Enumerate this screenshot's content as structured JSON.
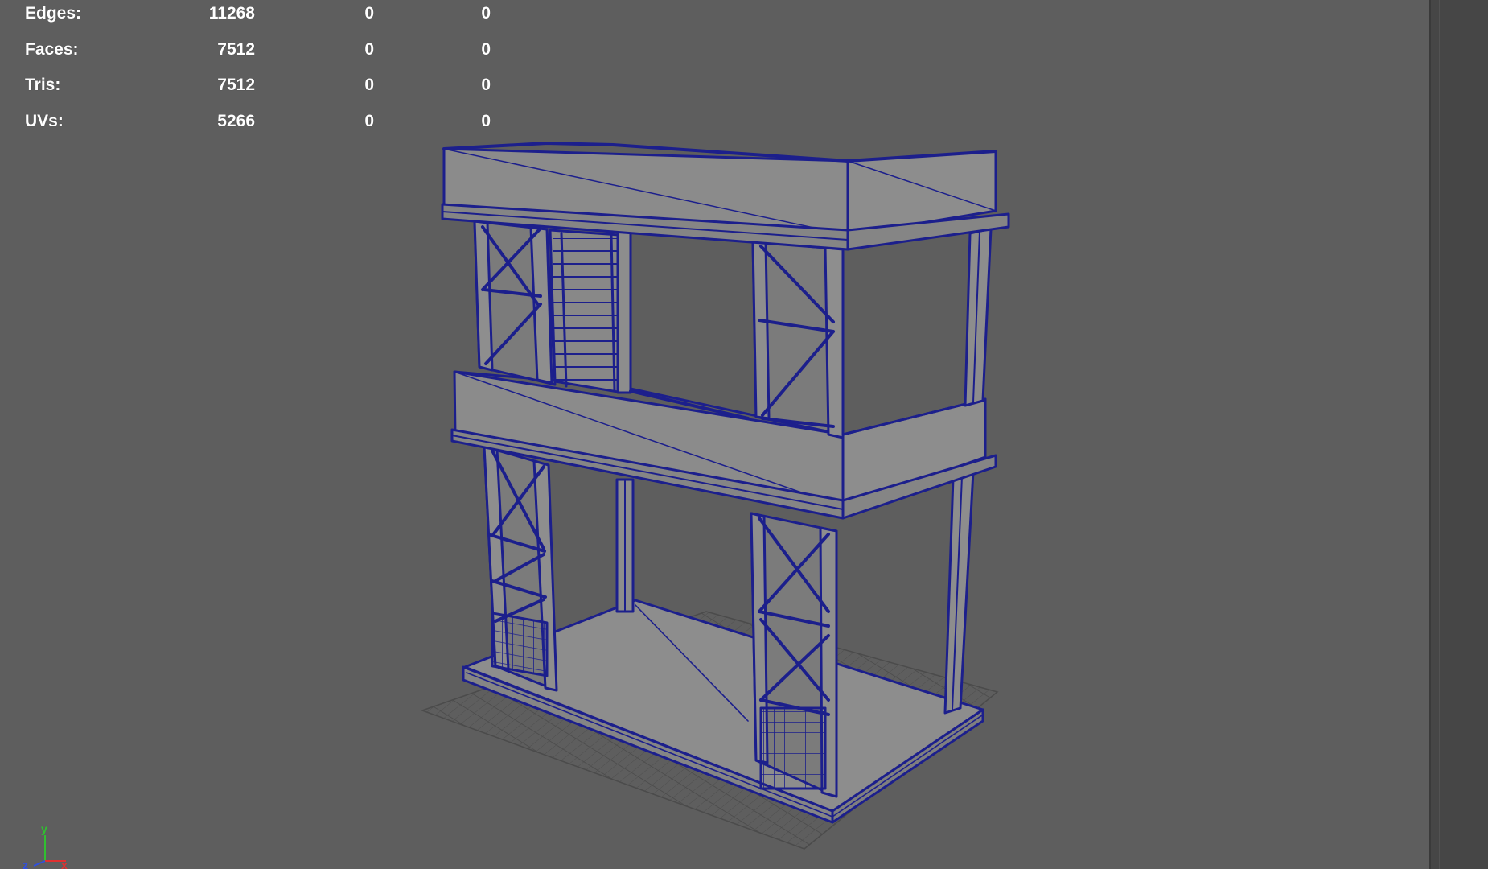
{
  "hud": {
    "rows": [
      {
        "label": "Edges:",
        "object": "11268",
        "selected": "0",
        "components": "0"
      },
      {
        "label": "Faces:",
        "object": "7512",
        "selected": "0",
        "components": "0"
      },
      {
        "label": "Tris:",
        "object": "7512",
        "selected": "0",
        "components": "0"
      },
      {
        "label": "UVs:",
        "object": "5266",
        "selected": "0",
        "components": "0"
      }
    ]
  },
  "axis_gizmo": {
    "y_label": "y",
    "z_label": "z",
    "x_label": "x",
    "colors": {
      "x": "#e03030",
      "y": "#30c030",
      "z": "#3050e0"
    }
  },
  "viewport": {
    "background": "#5e5e5e",
    "wireframe_color": "#1c1f8c",
    "surface_color": "#8d8d8d",
    "grid_color": "#4a4a4a"
  }
}
